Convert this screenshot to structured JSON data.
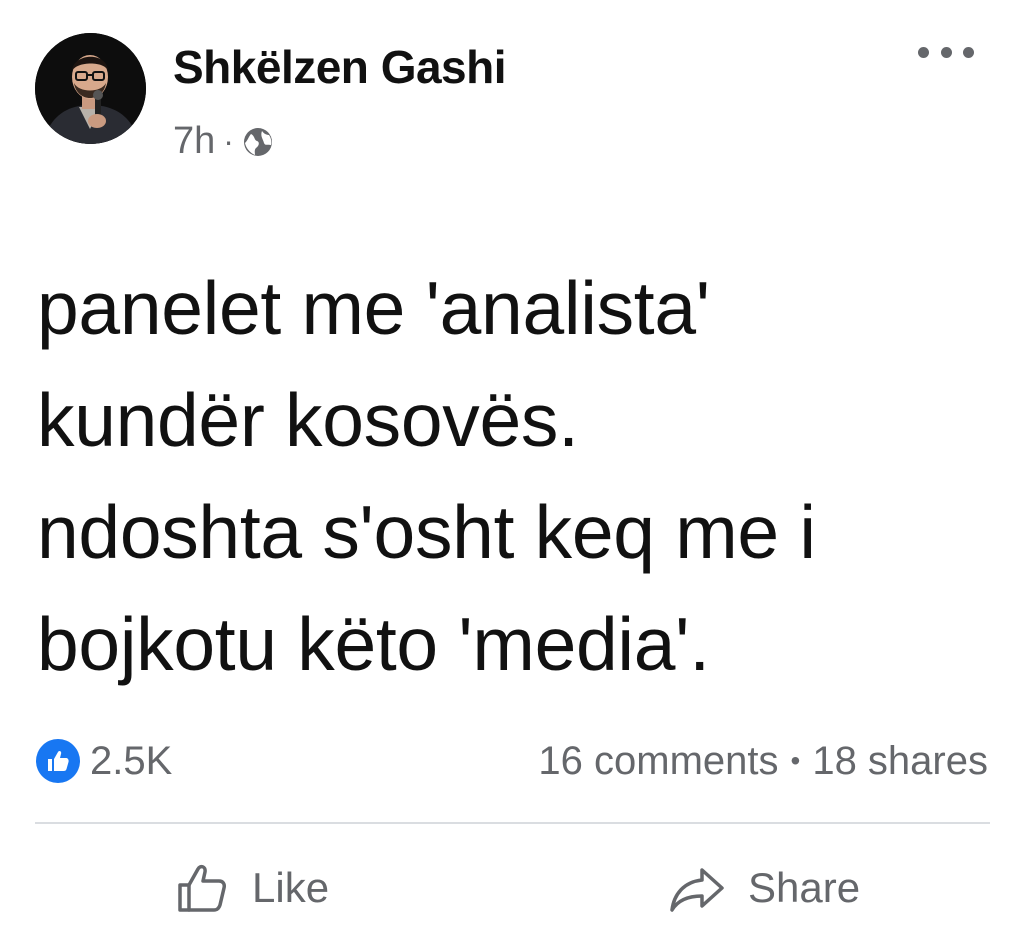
{
  "post": {
    "author": {
      "name": "Shkëlzen Gashi"
    },
    "timestamp": "7h",
    "separator": "·",
    "audience_icon": "globe-icon",
    "more_icon": "more-options-icon",
    "text_lines": [
      "panelet me 'analista'",
      "kundër kosovës.",
      "ndoshta s'osht keq me i",
      "bojkotu këto 'media'."
    ],
    "stats": {
      "reaction_icon": "like-reaction-icon",
      "reactions": "2.5K",
      "comments": "16 comments",
      "dot": "•",
      "shares": "18 shares"
    },
    "actions": {
      "like": {
        "label": "Like",
        "icon": "thumbs-up-icon"
      },
      "share": {
        "label": "Share",
        "icon": "share-arrow-icon"
      }
    },
    "colors": {
      "text": "#111111",
      "secondary": "#65676b",
      "reaction_blue": "#1877f2",
      "divider": "#dadde1"
    }
  }
}
